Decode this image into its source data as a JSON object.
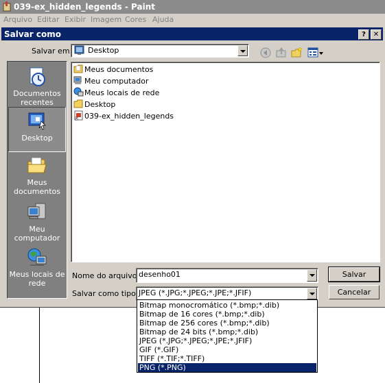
{
  "app": {
    "title": "039-ex_hidden_legends - Paint",
    "menu": [
      "Arquivo",
      "Editar",
      "Exibir",
      "Imagem",
      "Cores",
      "Ajuda"
    ]
  },
  "dialog": {
    "title": "Salvar como",
    "help_label": "?",
    "close_label": "✕",
    "save_in_label": "Salvar em:",
    "save_in_value": "Desktop",
    "places": [
      {
        "label": "Documentos recentes",
        "icon": "recent-documents-icon"
      },
      {
        "label": "Desktop",
        "icon": "desktop-icon",
        "selected": true
      },
      {
        "label": "Meus documentos",
        "icon": "my-documents-icon"
      },
      {
        "label": "Meu computador",
        "icon": "my-computer-icon"
      },
      {
        "label": "Meus locais de rede",
        "icon": "network-places-icon"
      }
    ],
    "files": [
      {
        "name": "Meus documentos",
        "icon": "my-documents-icon"
      },
      {
        "name": "Meu computador",
        "icon": "my-computer-icon"
      },
      {
        "name": "Meus locais de rede",
        "icon": "network-places-icon"
      },
      {
        "name": "Desktop",
        "icon": "folder-icon"
      },
      {
        "name": "039-ex_hidden_legends",
        "icon": "shortcut-icon"
      }
    ],
    "filename_label": "Nome do arquivo:",
    "filename_value": "desenho01",
    "filetype_label": "Salvar como tipo:",
    "filetype_value": "JPEG (*.JPG;*.JPEG;*.JPE;*.JFIF)",
    "save_button": "Salvar",
    "cancel_button": "Cancelar",
    "filetype_options": [
      "Bitmap monocromático (*.bmp;*.dib)",
      "Bitmap de 16 cores (*.bmp;*.dib)",
      "Bitmap de 256 cores (*.bmp;*.dib)",
      "Bitmap de 24 bits (*.bmp;*.dib)",
      "JPEG (*.JPG;*.JPEG;*.JPE;*.JFIF)",
      "GIF (*.GIF)",
      "TIFF (*.TIF;*.TIFF)",
      "PNG (*.PNG)"
    ],
    "highlighted_option": "PNG (*.PNG)"
  },
  "colors": {
    "title_active": "#0a246a",
    "title_inactive": "#8c8c8c",
    "face": "#d4d0c8",
    "places_bg": "#808080"
  }
}
